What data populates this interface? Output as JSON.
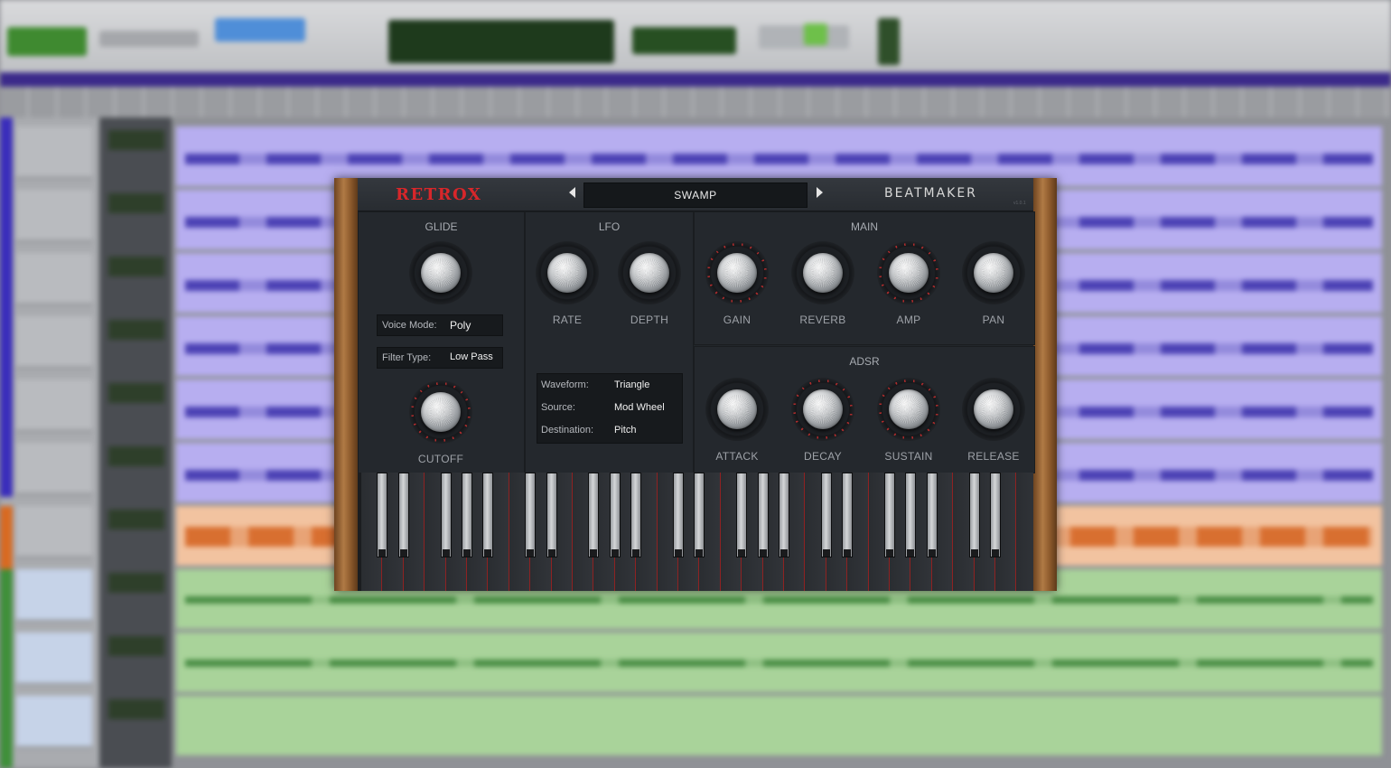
{
  "plugin": {
    "brand_left": "RETROX",
    "brand_right": "BEATMAKER",
    "version": "v1.0.1",
    "preset": "SWAMP",
    "glide": {
      "title": "GLIDE",
      "cutoff_label": "CUTOFF",
      "voice_mode_label": "Voice Mode:",
      "voice_mode_value": "Poly",
      "filter_type_label": "Filter Type:",
      "filter_type_value": "Low Pass"
    },
    "lfo": {
      "title": "LFO",
      "rate_label": "RATE",
      "depth_label": "DEPTH",
      "waveform_label": "Waveform:",
      "waveform_value": "Triangle",
      "source_label": "Source:",
      "source_value": "Mod Wheel",
      "destination_label": "Destination:",
      "destination_value": "Pitch"
    },
    "main": {
      "title": "MAIN",
      "gain_label": "GAIN",
      "reverb_label": "REVERB",
      "amp_label": "AMP",
      "pan_label": "PAN"
    },
    "adsr": {
      "title": "ADSR",
      "attack_label": "ATTACK",
      "decay_label": "DECAY",
      "sustain_label": "SUSTAIN",
      "release_label": "RELEASE"
    }
  },
  "colors": {
    "brand_red": "#d8262a",
    "panel_bg": "#24282d",
    "wood": "#a06a38",
    "track_purple": "#b7aef0",
    "track_orange": "#f2c3a0",
    "track_green": "#a9d39a"
  }
}
